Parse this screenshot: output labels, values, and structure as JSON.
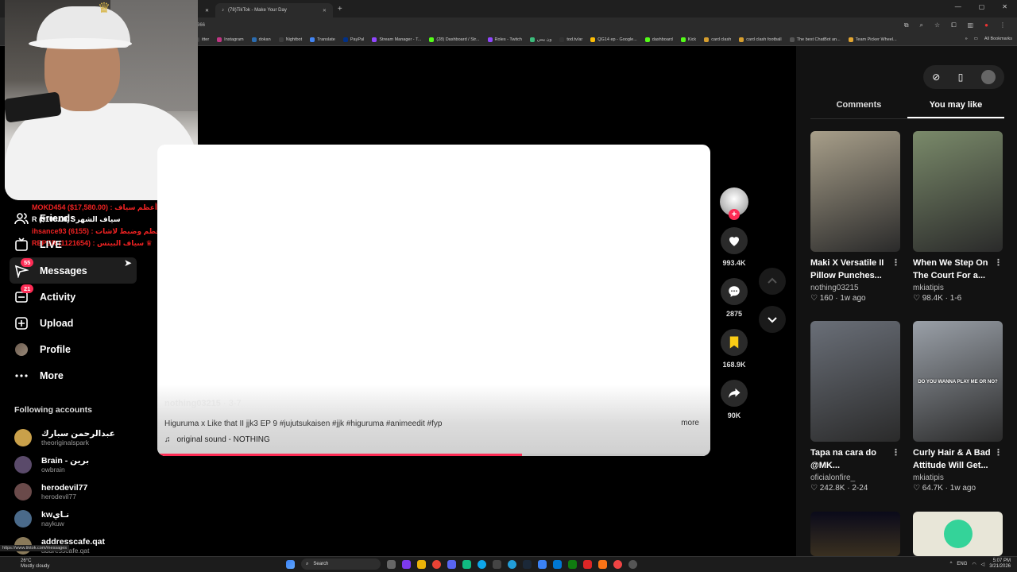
{
  "browser": {
    "tabs": [
      {
        "title": "",
        "active": false
      },
      {
        "title": "(78)TikTok - Make Your Day",
        "active": true
      }
    ],
    "url_fragment": "366",
    "bookmarks": [
      {
        "label": "itter",
        "color": "#444"
      },
      {
        "label": "Instagram",
        "color": "#c13584"
      },
      {
        "label": "dokan",
        "color": "#2b6cb0"
      },
      {
        "label": "Nightbot",
        "color": "#3d3d3d"
      },
      {
        "label": "Translate",
        "color": "#4285f4"
      },
      {
        "label": "PayPal",
        "color": "#003087"
      },
      {
        "label": "Stream Manager - T...",
        "color": "#9146ff"
      },
      {
        "label": "(28) Dashboard / Str...",
        "color": "#53fc18"
      },
      {
        "label": "Roles - Twitch",
        "color": "#9146ff"
      },
      {
        "label": "ون بيس",
        "color": "#3bbc7b"
      },
      {
        "label": "tod.tv/ar",
        "color": "#333"
      },
      {
        "label": "QG14 ep - Google...",
        "color": "#fbbc05"
      },
      {
        "label": "dashboard",
        "color": "#53fc18"
      },
      {
        "label": "Kick",
        "color": "#53fc18"
      },
      {
        "label": "card clash",
        "color": "#d69e2e"
      },
      {
        "label": "card clash football",
        "color": "#d69e2e"
      },
      {
        "label": "The best ChatBot an...",
        "color": "#555"
      },
      {
        "label": "Team Picker Wheel...",
        "color": "#e2a531"
      }
    ],
    "all_bookmarks": "All Bookmarks"
  },
  "overlay": {
    "donations": [
      {
        "text": "MOKD454 ($17,580.00) : أعظم سياف ♛",
        "style": "red"
      },
      {
        "text": "R ($106.00) : سياف الشهر",
        "style": "white"
      },
      {
        "text": "ihsance93 (6155) : أعظم وضبط لاشات ♛",
        "style": "red"
      },
      {
        "text": "REPER (1121654) : سياف البيتس ♛",
        "style": "red"
      }
    ]
  },
  "sidebar": {
    "items": [
      {
        "label": "Friends",
        "icon": "friends-icon",
        "badge": ""
      },
      {
        "label": "LIVE",
        "icon": "live-icon",
        "badge": ""
      },
      {
        "label": "Messages",
        "icon": "messages-icon",
        "badge": "55"
      },
      {
        "label": "Activity",
        "icon": "activity-icon",
        "badge": "21"
      },
      {
        "label": "Upload",
        "icon": "upload-icon",
        "badge": ""
      },
      {
        "label": "Profile",
        "icon": "profile-avatar",
        "badge": ""
      },
      {
        "label": "More",
        "icon": "more-icon",
        "badge": ""
      }
    ],
    "following_title": "Following accounts",
    "following": [
      {
        "name": "عبدالرحمن سبارك",
        "handle": "theoriginalspark",
        "color": "#c9a04a"
      },
      {
        "name": "برين - Brain",
        "handle": "owbrain",
        "color": "#5a4a6a"
      },
      {
        "name": "herodevil77",
        "handle": "herodevil77",
        "color": "#6a4a4a"
      },
      {
        "name": "kwنـاي",
        "handle": "naykuw",
        "color": "#4a6a8a"
      },
      {
        "name": "addresscafe.qat",
        "handle": "addresscafe.qat",
        "color": "#8a7a5a"
      }
    ],
    "status_url": "https://www.tiktok.com/messages"
  },
  "video": {
    "author": "nothing03215",
    "date": "· 3-7",
    "caption": "Higuruma x Like that II jjk3 EP 9 #jujutsukaisen #jjk #higuruma #animeedit #fyp",
    "more": "more",
    "sound": "original sound - NOTHING",
    "progress": 0.66
  },
  "actions": [
    {
      "icon": "heart-icon",
      "count": "993.4K",
      "color": "#ffffff"
    },
    {
      "icon": "comment-icon",
      "count": "2875",
      "color": "#ffffff"
    },
    {
      "icon": "bookmark-icon",
      "count": "168.9K",
      "color": "#facc15"
    },
    {
      "icon": "share-icon",
      "count": "90K",
      "color": "#ffffff"
    }
  ],
  "right_panel": {
    "tabs": [
      "Comments",
      "You may like"
    ],
    "active_tab": "You may like",
    "cards": [
      {
        "title1": "Maki X Versatile II",
        "title2": "Pillow Punches...",
        "author": "nothing03215",
        "likes": "160",
        "age": "1w ago",
        "bg": "#a89f8a"
      },
      {
        "title1": "When We Step On",
        "title2": "The Court For a...",
        "author": "mkiatipis",
        "likes": "98.4K",
        "age": "1-6",
        "bg": "#7a8a6a"
      },
      {
        "title1": "Tapa na cara do",
        "title2": "@MK...",
        "author": "oficialonfire_",
        "likes": "242.8K",
        "age": "2-24",
        "bg": "#6a6f78"
      },
      {
        "title1": "Curly Hair & A Bad",
        "title2": "Attitude Will Get...",
        "author": "mkiatipis",
        "likes": "64.7K",
        "age": "1w ago",
        "bg": "#9aa0a8",
        "overlay": "DO YOU WANNA PLAY ME OR NO?"
      }
    ]
  },
  "taskbar": {
    "weather_temp": "26°C",
    "weather_desc": "Mostly cloudy",
    "search": "Search",
    "lang": "ENG",
    "time": "5:07 PM",
    "date": "3/21/2026"
  }
}
